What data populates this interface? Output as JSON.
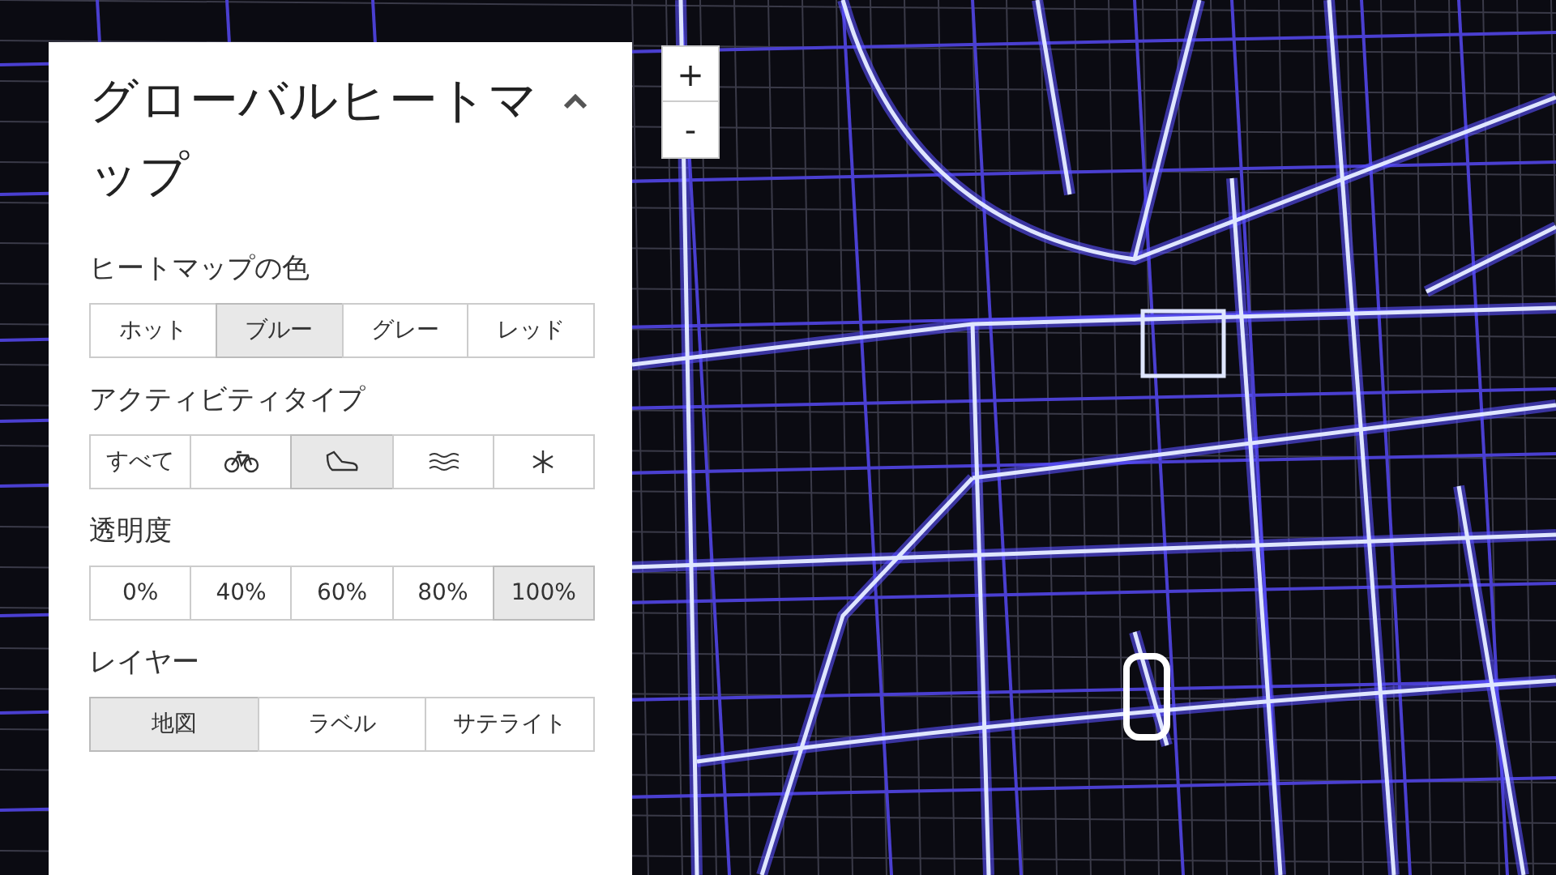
{
  "panel": {
    "title": "グローバルヒートマップ",
    "expanded": true,
    "sections": [
      {
        "label": "ヒートマップの色",
        "options": [
          {
            "kind": "text",
            "label": "ホット",
            "selected": false
          },
          {
            "kind": "text",
            "label": "ブルー",
            "selected": true
          },
          {
            "kind": "text",
            "label": "グレー",
            "selected": false
          },
          {
            "kind": "text",
            "label": "レッド",
            "selected": false
          }
        ]
      },
      {
        "label": "アクティビティタイプ",
        "options": [
          {
            "kind": "text",
            "label": "すべて",
            "selected": false
          },
          {
            "kind": "bike",
            "selected": false
          },
          {
            "kind": "shoe",
            "selected": true
          },
          {
            "kind": "water",
            "selected": false
          },
          {
            "kind": "snow",
            "selected": false
          }
        ]
      },
      {
        "label": "透明度",
        "options": [
          {
            "kind": "text",
            "label": "0%",
            "selected": false
          },
          {
            "kind": "text",
            "label": "40%",
            "selected": false
          },
          {
            "kind": "text",
            "label": "60%",
            "selected": false
          },
          {
            "kind": "text",
            "label": "80%",
            "selected": false
          },
          {
            "kind": "text",
            "label": "100%",
            "selected": true
          }
        ]
      },
      {
        "label": "レイヤー",
        "options": [
          {
            "kind": "text",
            "label": "地図",
            "selected": true
          },
          {
            "kind": "text",
            "label": "ラベル",
            "selected": false
          },
          {
            "kind": "text",
            "label": "サテライト",
            "selected": false
          }
        ]
      }
    ]
  },
  "zoom": {
    "in": "+",
    "out": "-"
  }
}
